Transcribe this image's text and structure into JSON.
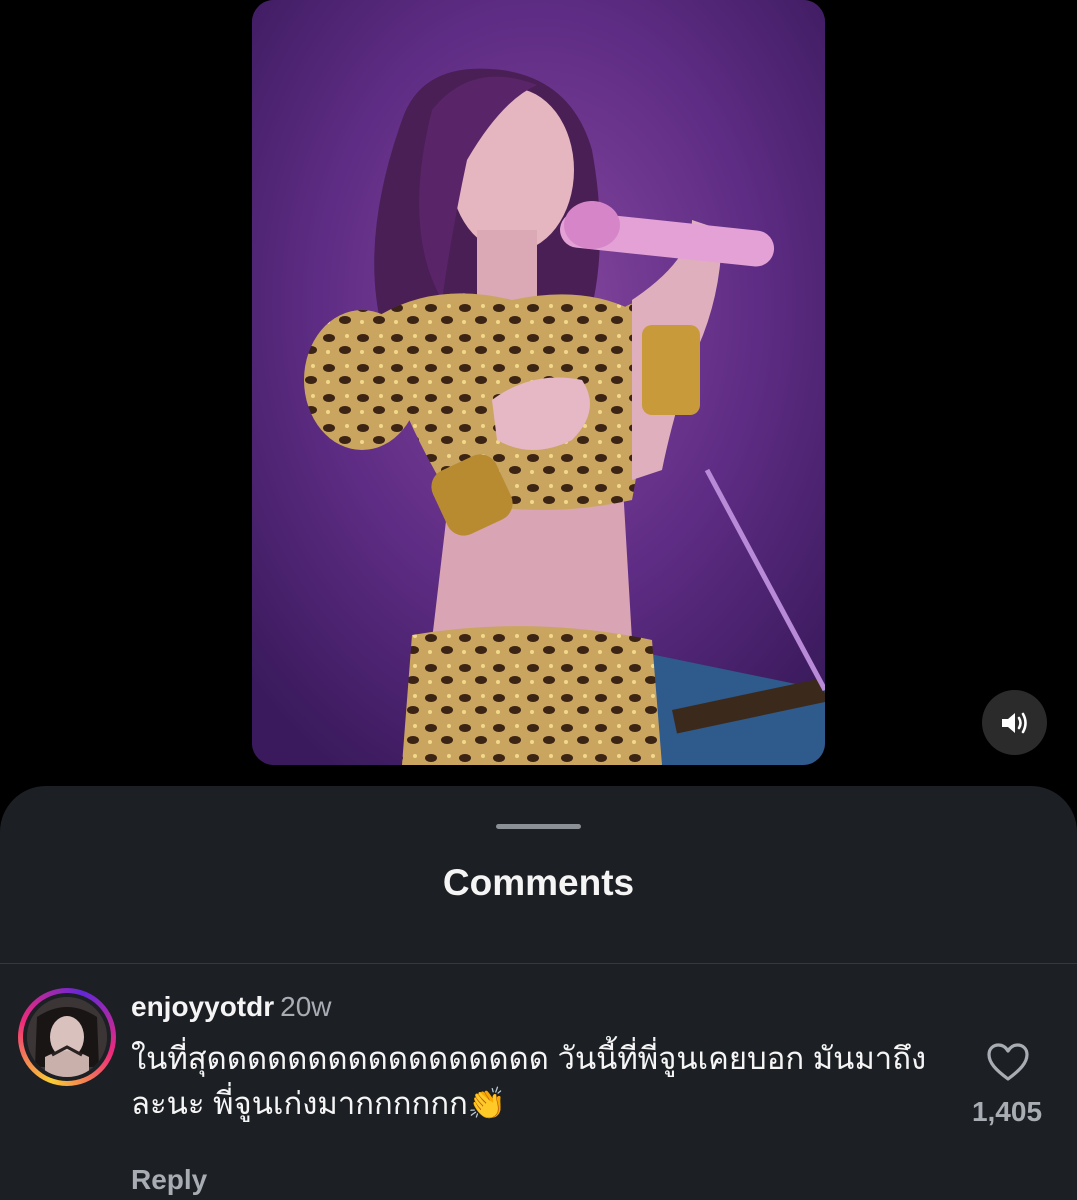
{
  "video": {
    "sound_icon": "speaker-on-icon"
  },
  "comments_sheet": {
    "title": "Comments",
    "comments": [
      {
        "username": "enjoyyotdr",
        "time": "20w",
        "text": "ในที่สุดดดดดดดดดดดดดดดดด วันนี้ที่พี่จูนเคยบอก มันมาถึงละนะ พี่จูนเก่งมากกกกกก👏",
        "like_count": "1,405",
        "like_icon": "heart-outline-icon",
        "reply_label": "Reply"
      }
    ]
  },
  "colors": {
    "sheet_background": "#1c1f24",
    "primary_text": "#f5f5f5",
    "secondary_text": "#a8acb3",
    "video_backdrop": "#5b2a80"
  }
}
